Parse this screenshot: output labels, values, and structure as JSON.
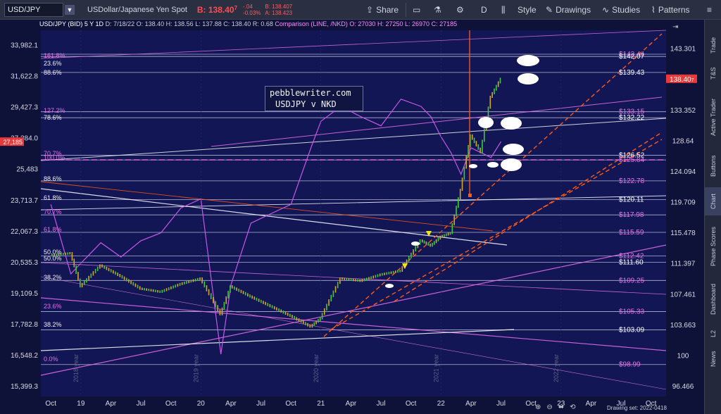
{
  "toolbar": {
    "symbol": "USD/JPY",
    "name": "USDollar/Japanese Yen Spot",
    "bid": "B: 138.40",
    "bid_small": "7",
    "change_line1": "-.04",
    "change_line2": "-0.03%",
    "bid_line": "B: 138.407",
    "ask_line": "A: 138.423",
    "share": "Share",
    "interval": "D",
    "style": "Style",
    "drawings": "Drawings",
    "studies": "Studies",
    "patterns": "Patterns"
  },
  "info": {
    "header": "USD/JPY (BID) 5 Y 1D",
    "date": "D: 7/18/22",
    "open": "O: 138.40",
    "high": "H: 138.56",
    "low": "L: 137.88",
    "close": "C: 138.40",
    "range": "R: 0.68",
    "comparison": "Comparison (LINE, /NKD)",
    "c_open": "O: 27030",
    "c_high": "H: 27250",
    "c_low": "L: 26970",
    "c_close": "C: 27185"
  },
  "right_tabs": [
    "Trade",
    "T&S",
    "Active Trader",
    "Buttons",
    "Chart",
    "Phase Scores",
    "Dashboard",
    "L2",
    "News"
  ],
  "status_text": "Drawing set: 2022-0418",
  "watermark_lines": [
    "pebblewriter.com",
    "USDJPY v NKD"
  ],
  "colors": {
    "background": "#0f1238",
    "usdjpy_up": "#3cc93c",
    "usdjpy_down": "#d4a72c",
    "nkd": "#c658e6",
    "fib": "#e86fe8",
    "trend_orange": "#ff5a14",
    "price_tag": "#e83a3a"
  },
  "chart_data": {
    "type": "line",
    "title": "USD/JPY (BID) 5 Y 1D",
    "x_ticks": [
      "Oct",
      "19",
      "Apr",
      "Jul",
      "Oct",
      "20",
      "Apr",
      "Jul",
      "Oct",
      "21",
      "Apr",
      "Jul",
      "Oct",
      "22",
      "Apr",
      "Jul",
      "Oct",
      "23",
      "Apr",
      "Jul",
      "Oct"
    ],
    "year_labels": [
      "2018 year",
      "2019 year",
      "2020 year",
      "2021 year",
      "2022 year"
    ],
    "left_axis_ticks": [
      "33,982.1",
      "31,622.8",
      "29,427.3",
      "27,384.0",
      "25,483",
      "23,713.7",
      "22,067.3",
      "20,535.3",
      "19,109.5",
      "17,782.8",
      "16,548.2",
      "15,399.3"
    ],
    "left_axis_current": "27,185",
    "right_axis_ticks": [
      "143.301",
      "133.352",
      "128.64",
      "124.094",
      "119.709",
      "115.478",
      "111.397",
      "107.461",
      "103.663",
      "100",
      "96.466"
    ],
    "right_axis_current": "138.40",
    "right_axis_current_small": "7",
    "ylim_usdjpy": [
      96.466,
      146.5
    ],
    "log_scale": true,
    "grid": false,
    "fib_left_labels": [
      "161.8%",
      "23.6%",
      "88.6%",
      "127.2%",
      "78.6%",
      "70.7%",
      "100.0%",
      "88.6%",
      "61.8%",
      "70.7%",
      "61.8%",
      "50.0%",
      "50.0%",
      "38.2%",
      "23.6%",
      "38.2%",
      "0.0%"
    ],
    "level_labels": [
      {
        "text": "$142.44",
        "value": 142.44
      },
      {
        "text": "$142.07",
        "value": 142.07
      },
      {
        "text": "$139.43",
        "value": 139.43
      },
      {
        "text": "$133.15",
        "value": 133.15
      },
      {
        "text": "$132.22",
        "value": 132.22
      },
      {
        "text": "$126.52",
        "value": 126.52
      },
      {
        "text": "$125.84",
        "value": 125.84
      },
      {
        "text": "$122.78",
        "value": 122.78
      },
      {
        "text": "$120.11",
        "value": 120.11
      },
      {
        "text": "$117.98",
        "value": 117.98
      },
      {
        "text": "$115.59",
        "value": 115.59
      },
      {
        "text": "$112.42",
        "value": 112.42
      },
      {
        "text": "$111.60",
        "value": 111.6
      },
      {
        "text": "$109.25",
        "value": 109.25
      },
      {
        "text": "$105.33",
        "value": 105.33
      },
      {
        "text": "$103.09",
        "value": 103.09
      },
      {
        "text": "$98.99",
        "value": 98.99
      }
    ],
    "series": [
      {
        "name": "USD/JPY",
        "style": "candles",
        "x": [
          "2018-10",
          "2018-12",
          "2019-01",
          "2019-03",
          "2019-05",
          "2019-07",
          "2019-09",
          "2019-11",
          "2020-01",
          "2020-03",
          "2020-04",
          "2020-06",
          "2020-08",
          "2020-10",
          "2020-12",
          "2021-01",
          "2021-03",
          "2021-05",
          "2021-07",
          "2021-09",
          "2021-11",
          "2021-12",
          "2022-01",
          "2022-02",
          "2022-03",
          "2022-04",
          "2022-05",
          "2022-06",
          "2022-07"
        ],
        "values": [
          112.5,
          112.8,
          108.5,
          111.2,
          109.8,
          108.2,
          107.8,
          108.8,
          109.5,
          105.0,
          108.5,
          107.2,
          106.0,
          104.8,
          103.5,
          104.5,
          109.5,
          109.2,
          110.0,
          110.5,
          114.5,
          113.8,
          115.0,
          115.5,
          121.5,
          129.5,
          127.0,
          135.5,
          138.4
        ]
      },
      {
        "name": "/NKD",
        "style": "line",
        "x": [
          "2018-10",
          "2018-12",
          "2019-01",
          "2019-03",
          "2019-05",
          "2019-07",
          "2019-09",
          "2019-11",
          "2020-01",
          "2020-03",
          "2020-04",
          "2020-06",
          "2020-08",
          "2020-10",
          "2020-12",
          "2021-01",
          "2021-03",
          "2021-05",
          "2021-07",
          "2021-09",
          "2021-11",
          "2021-12",
          "2022-01",
          "2022-02",
          "2022-03",
          "2022-04",
          "2022-05",
          "2022-06",
          "2022-07"
        ],
        "values": [
          23500,
          20000,
          20500,
          21500,
          20800,
          21600,
          22000,
          23300,
          23800,
          16600,
          19500,
          22500,
          23000,
          23500,
          26800,
          28500,
          29500,
          28800,
          28200,
          30000,
          29500,
          28800,
          27500,
          26500,
          25200,
          26800,
          26500,
          26200,
          27185
        ]
      }
    ]
  }
}
